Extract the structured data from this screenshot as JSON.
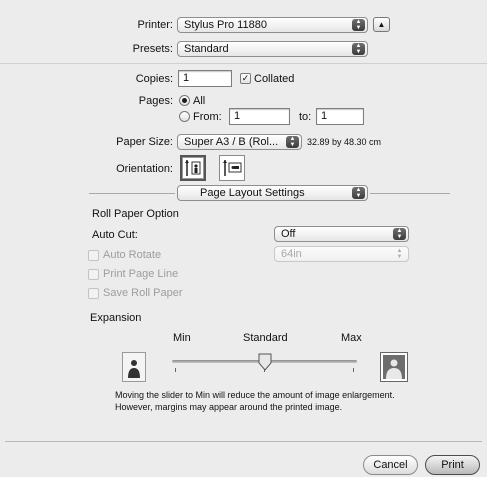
{
  "print": {
    "printer_label": "Printer:",
    "printer_value": "Stylus Pro 11880",
    "presets_label": "Presets:",
    "presets_value": "Standard",
    "copies_label": "Copies:",
    "copies_value": "1",
    "collated_label": "Collated",
    "collated_checked": true,
    "pages_label": "Pages:",
    "pages_all": "All",
    "pages_from": "From:",
    "pages_from_value": "1",
    "pages_to": "to:",
    "pages_to_value": "1",
    "paper_size_label": "Paper Size:",
    "paper_size_value": "Super A3 / B (Rol...",
    "paper_size_dims": "32.89 by 48.30 cm",
    "orientation_label": "Orientation:",
    "section_value": "Page Layout Settings"
  },
  "roll": {
    "title": "Roll Paper Option",
    "auto_cut_label": "Auto Cut:",
    "auto_cut_value": "Off",
    "auto_rotate": "Auto Rotate",
    "auto_rotate_value": "64in",
    "print_page_line": "Print Page Line",
    "save_roll_paper": "Save Roll Paper"
  },
  "expansion": {
    "title": "Expansion",
    "min": "Min",
    "standard": "Standard",
    "max": "Max",
    "slider_level": 0.5,
    "description_line1": "Moving the slider to Min will reduce the amount of image enlargement.",
    "description_line2": "However, margins may appear around the printed image."
  },
  "buttons": {
    "cancel": "Cancel",
    "print": "Print"
  },
  "icons": {
    "popup_arrows": "⬍",
    "disclosure": "▲"
  }
}
